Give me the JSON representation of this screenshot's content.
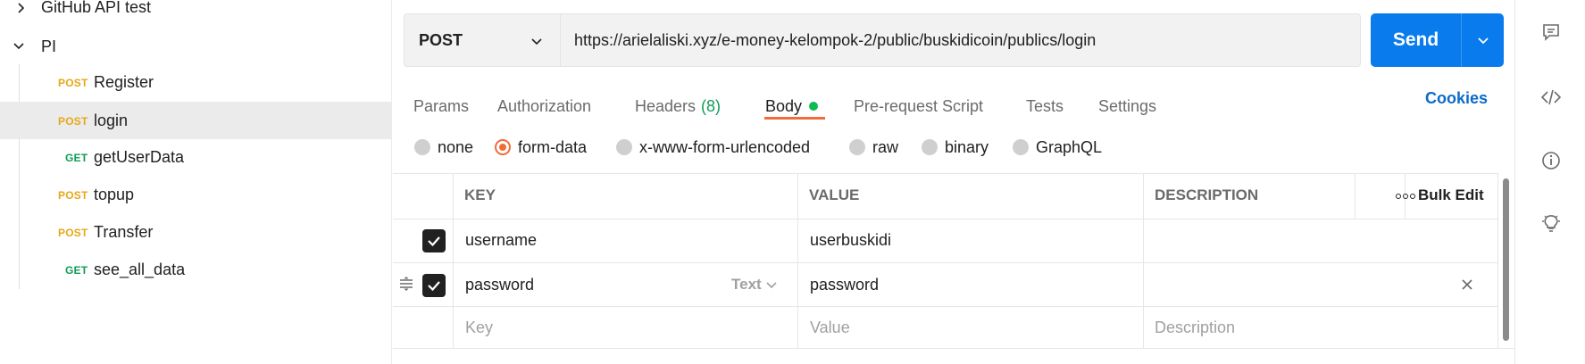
{
  "sidebar": {
    "items": [
      {
        "label": "GitHub API test",
        "type": "folder",
        "expanded": false
      },
      {
        "label": "PI",
        "type": "folder",
        "expanded": true
      },
      {
        "method": "POST",
        "label": "Register"
      },
      {
        "method": "POST",
        "label": "login",
        "selected": true
      },
      {
        "method": "GET",
        "label": "getUserData"
      },
      {
        "method": "POST",
        "label": "topup"
      },
      {
        "method": "POST",
        "label": "Transfer"
      },
      {
        "method": "GET",
        "label": "see_all_data"
      }
    ]
  },
  "request": {
    "method": "POST",
    "url": "https://arielaliski.xyz/e-money-kelompok-2/public/buskidicoin/publics/login",
    "send_label": "Send"
  },
  "tabs": {
    "params": "Params",
    "authorization": "Authorization",
    "headers": "Headers",
    "headers_count": "(8)",
    "body": "Body",
    "prerequest": "Pre-request Script",
    "tests": "Tests",
    "settings": "Settings",
    "active": "Body"
  },
  "cookies_label": "Cookies",
  "body_types": {
    "none": "none",
    "form_data": "form-data",
    "urlencoded": "x-www-form-urlencoded",
    "raw": "raw",
    "binary": "binary",
    "graphql": "GraphQL",
    "selected": "form-data"
  },
  "table": {
    "headers": {
      "key": "KEY",
      "value": "VALUE",
      "description": "DESCRIPTION",
      "bulk_edit": "Bulk Edit"
    },
    "rows": [
      {
        "checked": true,
        "key": "username",
        "value": "userbuskidi",
        "description": ""
      },
      {
        "checked": true,
        "key": "password",
        "type": "Text",
        "value": "password",
        "description": ""
      }
    ],
    "placeholders": {
      "key": "Key",
      "value": "Value",
      "description": "Description"
    }
  },
  "colors": {
    "accent": "#f26b3a",
    "send": "#097bed",
    "post": "#e6a817",
    "get": "#0f9d58",
    "cookies": "#0b6bcb"
  },
  "rail_icons": [
    "comment-icon",
    "code-icon",
    "info-icon",
    "lightbulb-icon"
  ]
}
